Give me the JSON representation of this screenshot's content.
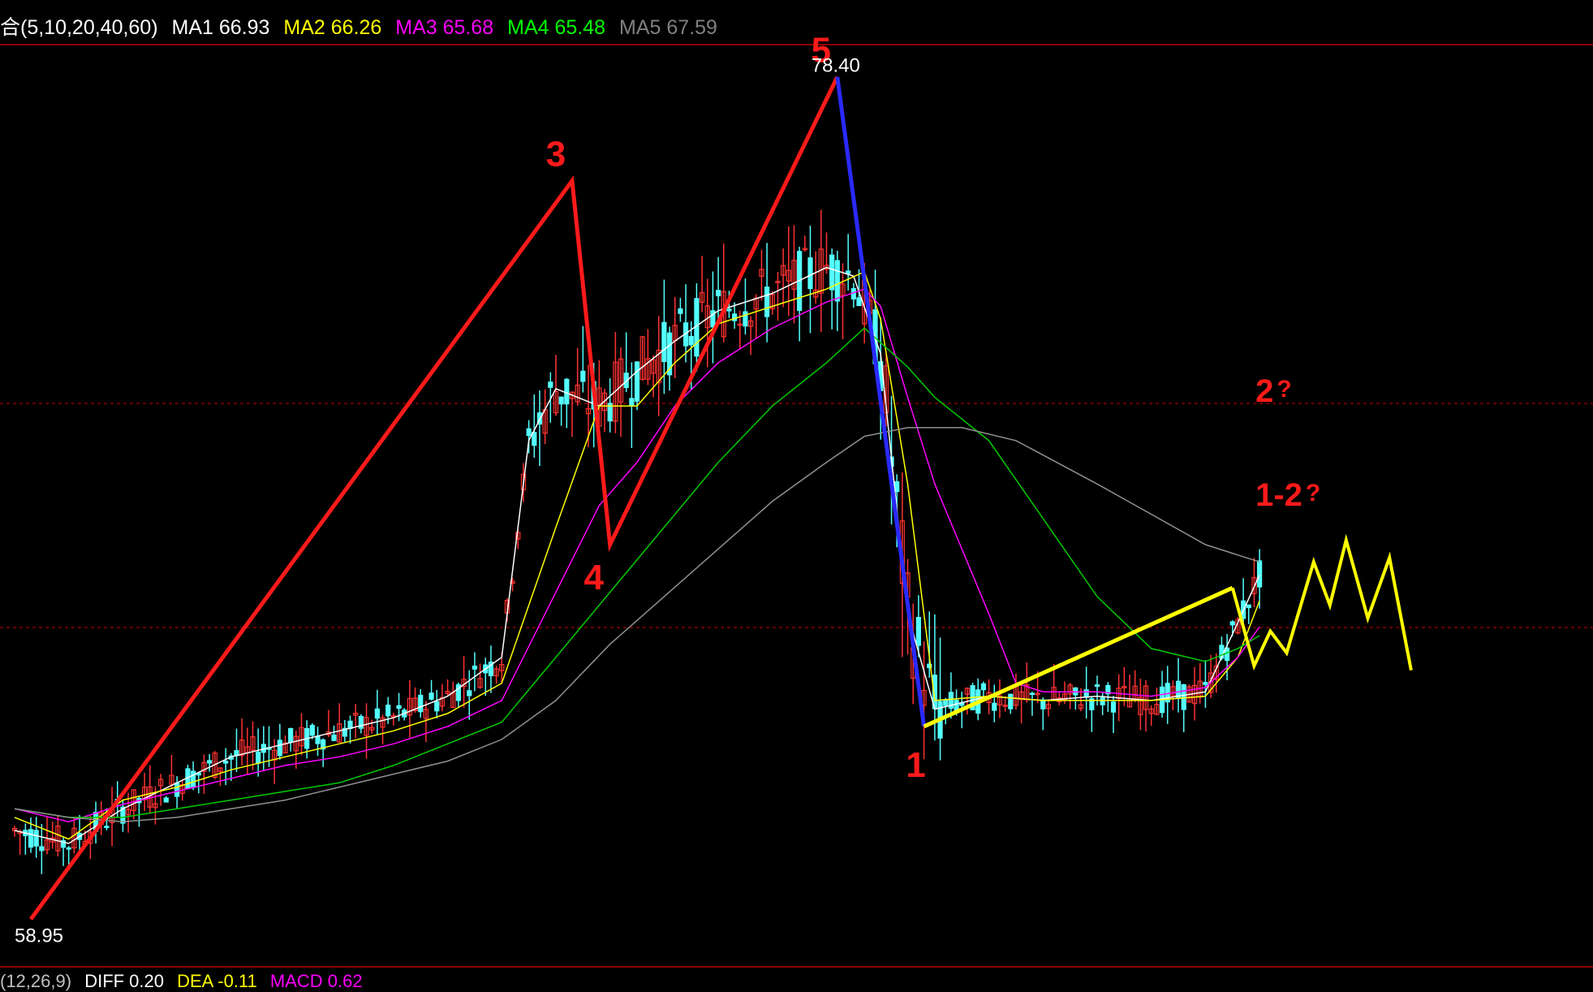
{
  "legend": {
    "params": "合(5,10,20,40,60)",
    "items": [
      {
        "text": "MA1 66.93",
        "color": "#ffffff"
      },
      {
        "text": "MA2 66.26",
        "color": "#ffff00"
      },
      {
        "text": "MA3 65.68",
        "color": "#ff00ff"
      },
      {
        "text": "MA4 65.48",
        "color": "#00ff00"
      },
      {
        "text": "MA5 67.59",
        "color": "#808080"
      }
    ]
  },
  "macd_legend": {
    "items": [
      {
        "text": "(12,26,9)",
        "color": "#c0c0c0"
      },
      {
        "text": "DIFF 0.20",
        "color": "#ffffff"
      },
      {
        "text": "DEA -0.11",
        "color": "#ffff00"
      },
      {
        "text": "MACD 0.62",
        "color": "#ff00ff"
      }
    ]
  },
  "colors": {
    "background": "#000000",
    "up_candle": "#ff3232",
    "down_candle": "#54ffff",
    "grid": "#8b0000",
    "wave_main": "#ff1a1a",
    "wave_c": "#2a2aff",
    "wave_new": "#ffff00",
    "annotation": "#ff1a1a"
  },
  "chart_data": {
    "type": "candlestick",
    "y_range": [
      58.0,
      79.5
    ],
    "price_labels": [
      {
        "text": "78.40",
        "date_index": 152,
        "value": 78.4
      },
      {
        "text": "58.95",
        "date_index": 3,
        "value": 58.95
      }
    ],
    "ma_lines": {
      "MA1": [
        [
          0,
          61.0
        ],
        [
          10,
          60.7
        ],
        [
          20,
          61.5
        ],
        [
          30,
          62.1
        ],
        [
          40,
          62.7
        ],
        [
          50,
          63.0
        ],
        [
          60,
          63.3
        ],
        [
          70,
          63.6
        ],
        [
          80,
          64.1
        ],
        [
          90,
          65.0
        ],
        [
          95,
          70.0
        ],
        [
          100,
          71.2
        ],
        [
          108,
          70.8
        ],
        [
          115,
          71.6
        ],
        [
          122,
          72.3
        ],
        [
          130,
          73.0
        ],
        [
          140,
          73.4
        ],
        [
          150,
          74.0
        ],
        [
          155,
          73.8
        ],
        [
          160,
          72.0
        ],
        [
          165,
          66.0
        ],
        [
          170,
          63.8
        ],
        [
          180,
          64.1
        ],
        [
          190,
          64.0
        ],
        [
          200,
          64.1
        ],
        [
          210,
          64.0
        ],
        [
          220,
          64.2
        ],
        [
          226,
          65.8
        ],
        [
          230,
          66.9
        ]
      ],
      "MA2": [
        [
          0,
          61.3
        ],
        [
          10,
          60.8
        ],
        [
          20,
          61.7
        ],
        [
          30,
          62.0
        ],
        [
          40,
          62.4
        ],
        [
          50,
          62.7
        ],
        [
          60,
          63.0
        ],
        [
          70,
          63.3
        ],
        [
          80,
          63.7
        ],
        [
          90,
          64.4
        ],
        [
          100,
          68.0
        ],
        [
          108,
          70.8
        ],
        [
          115,
          70.8
        ],
        [
          122,
          71.8
        ],
        [
          130,
          72.7
        ],
        [
          140,
          73.1
        ],
        [
          150,
          73.5
        ],
        [
          157,
          73.9
        ],
        [
          160,
          72.8
        ],
        [
          165,
          69.0
        ],
        [
          170,
          64.0
        ],
        [
          180,
          64.1
        ],
        [
          190,
          64.0
        ],
        [
          200,
          64.0
        ],
        [
          210,
          64.0
        ],
        [
          220,
          64.1
        ],
        [
          226,
          65.0
        ],
        [
          230,
          66.3
        ]
      ],
      "MA3": [
        [
          0,
          61.5
        ],
        [
          10,
          61.2
        ],
        [
          20,
          61.6
        ],
        [
          30,
          61.9
        ],
        [
          40,
          62.2
        ],
        [
          50,
          62.5
        ],
        [
          60,
          62.7
        ],
        [
          70,
          63.0
        ],
        [
          80,
          63.4
        ],
        [
          90,
          64.0
        ],
        [
          100,
          66.5
        ],
        [
          108,
          68.5
        ],
        [
          115,
          69.5
        ],
        [
          122,
          70.8
        ],
        [
          130,
          71.8
        ],
        [
          140,
          72.6
        ],
        [
          150,
          73.2
        ],
        [
          157,
          73.5
        ],
        [
          160,
          73.1
        ],
        [
          165,
          71.0
        ],
        [
          170,
          69.0
        ],
        [
          180,
          66.0
        ],
        [
          185,
          64.4
        ],
        [
          190,
          64.2
        ],
        [
          200,
          64.2
        ],
        [
          210,
          64.1
        ],
        [
          220,
          64.3
        ],
        [
          226,
          65.0
        ],
        [
          230,
          65.7
        ]
      ],
      "MA4": [
        [
          0,
          61.5
        ],
        [
          10,
          61.3
        ],
        [
          20,
          61.3
        ],
        [
          30,
          61.5
        ],
        [
          40,
          61.7
        ],
        [
          50,
          61.9
        ],
        [
          60,
          62.1
        ],
        [
          70,
          62.5
        ],
        [
          80,
          63.0
        ],
        [
          90,
          63.5
        ],
        [
          100,
          65.0
        ],
        [
          110,
          66.5
        ],
        [
          120,
          68.0
        ],
        [
          130,
          69.5
        ],
        [
          140,
          70.8
        ],
        [
          150,
          71.8
        ],
        [
          157,
          72.6
        ],
        [
          165,
          71.7
        ],
        [
          170,
          71.0
        ],
        [
          180,
          70.0
        ],
        [
          190,
          68.2
        ],
        [
          200,
          66.4
        ],
        [
          210,
          65.2
        ],
        [
          220,
          64.9
        ],
        [
          226,
          65.2
        ],
        [
          230,
          65.5
        ]
      ],
      "MA5": [
        [
          0,
          61.5
        ],
        [
          10,
          61.3
        ],
        [
          20,
          61.2
        ],
        [
          30,
          61.3
        ],
        [
          40,
          61.5
        ],
        [
          50,
          61.7
        ],
        [
          60,
          62.0
        ],
        [
          70,
          62.3
        ],
        [
          80,
          62.6
        ],
        [
          90,
          63.1
        ],
        [
          100,
          64.0
        ],
        [
          110,
          65.3
        ],
        [
          120,
          66.4
        ],
        [
          130,
          67.5
        ],
        [
          140,
          68.6
        ],
        [
          150,
          69.5
        ],
        [
          157,
          70.1
        ],
        [
          165,
          70.3
        ],
        [
          175,
          70.3
        ],
        [
          185,
          70.0
        ],
        [
          200,
          69.0
        ],
        [
          210,
          68.3
        ],
        [
          220,
          67.6
        ],
        [
          230,
          67.2
        ]
      ]
    },
    "waves": [
      {
        "labels": [
          "",
          "3",
          "4",
          "5"
        ],
        "points": [
          [
            3,
            58.95
          ],
          [
            103,
            76.0
          ],
          [
            110,
            67.6
          ],
          [
            152,
            78.4
          ]
        ]
      },
      {
        "labels": [
          "",
          "1"
        ],
        "points": [
          [
            152,
            78.4
          ],
          [
            168,
            63.4
          ]
        ]
      },
      {
        "labels": [
          "",
          ""
        ],
        "points": [
          [
            168,
            63.4
          ],
          [
            225,
            66.6
          ]
        ]
      }
    ],
    "projection": [
      [
        225,
        66.6
      ],
      [
        229,
        64.8
      ],
      [
        232,
        65.6
      ],
      [
        235,
        65.1
      ],
      [
        240,
        67.2
      ],
      [
        243,
        66.2
      ],
      [
        246,
        67.7
      ],
      [
        250,
        65.9
      ],
      [
        254,
        67.3
      ],
      [
        258,
        64.7
      ]
    ],
    "annotations": [
      {
        "text": "2",
        "mark": "?",
        "date_index": 233,
        "value": 70.9
      },
      {
        "text": "1-2",
        "mark": "?",
        "date_index": 233,
        "value": 68.5
      }
    ]
  }
}
